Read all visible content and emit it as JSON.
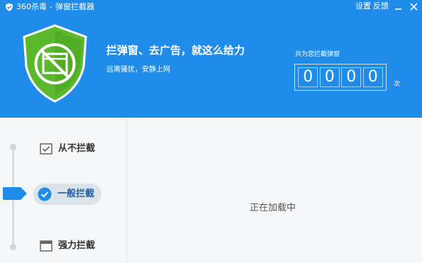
{
  "window": {
    "app_name": "360杀毒",
    "separator": "-",
    "tool_name": "弹窗拦截器",
    "settings_label": "设置",
    "feedback_label": "反馈"
  },
  "header": {
    "headline": "拦弹窗、去广告，就这么给力",
    "subline": "远离骚扰，安静上网",
    "counter_caption": "共为您拦截弹窗",
    "counter_digits": [
      "0",
      "0",
      "0",
      "0"
    ],
    "counter_unit": "次"
  },
  "modes": [
    {
      "label": "从不拦截",
      "icon": "checklist-icon"
    },
    {
      "label": "一般拦截",
      "icon": "check-circle-icon",
      "selected": true
    },
    {
      "label": "强力拦截",
      "icon": "window-icon"
    }
  ],
  "main": {
    "status_text": "正在加载中"
  },
  "colors": {
    "header_bg": "#1e8ce8",
    "shield_green": "#5cb82c",
    "accent_blue": "#1e8ce8",
    "content_bg": "#f4f6f8"
  }
}
